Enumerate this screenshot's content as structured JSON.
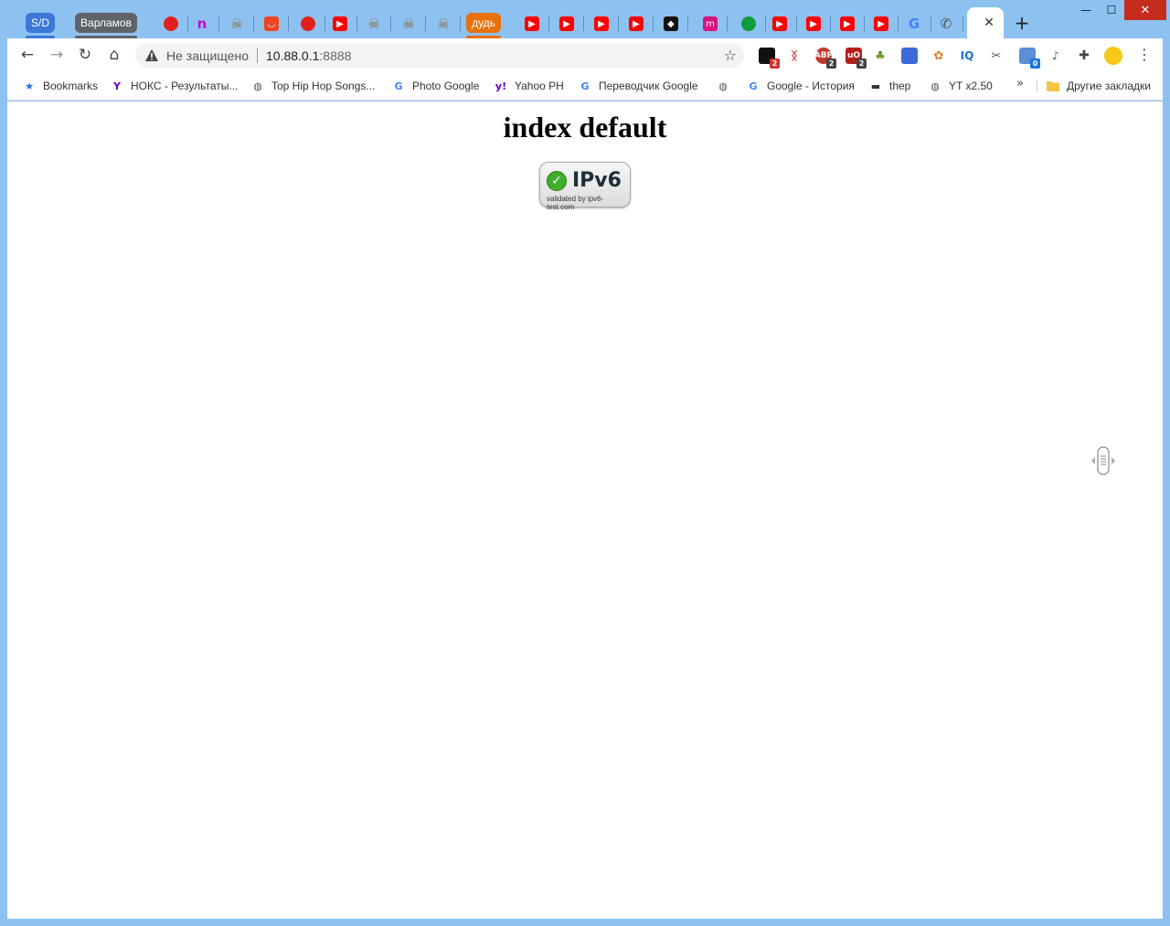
{
  "window": {
    "minimize_glyph": "—",
    "maximize_glyph": "☐",
    "close_glyph": "✕"
  },
  "tabs": {
    "group_sd": {
      "label": "S/D",
      "color": "#3b78d8"
    },
    "group_varlamov": {
      "label": "Варламов",
      "color": "#5f6368"
    },
    "group_dud": {
      "label": "дудь",
      "color": "#e8710a"
    },
    "favicons": [
      {
        "name": "red-dot-icon",
        "color": "#e0211b"
      },
      {
        "name": "purple-n-icon",
        "color": "#c40adb"
      },
      {
        "name": "pirate-icon",
        "color": "#8b6c3c"
      },
      {
        "name": "aliexpress-icon",
        "color": "#ee4422"
      },
      {
        "name": "red-dot-icon",
        "color": "#e0211b"
      },
      {
        "name": "youtube-icon",
        "color": "#ff0000"
      },
      {
        "name": "pirate-icon",
        "color": "#8b6c3c"
      },
      {
        "name": "pirate-icon",
        "color": "#8b6c3c"
      },
      {
        "name": "pirate-icon",
        "color": "#8b6c3c"
      },
      {
        "name": "youtube-icon",
        "color": "#ff0000"
      },
      {
        "name": "youtube-icon",
        "color": "#ff0000"
      },
      {
        "name": "youtube-icon",
        "color": "#ff0000"
      },
      {
        "name": "youtube-icon",
        "color": "#ff0000"
      },
      {
        "name": "black-diamond-icon",
        "color": "#111111"
      },
      {
        "name": "magenta-m-icon",
        "color": "#d6157f"
      },
      {
        "name": "green-dot-icon",
        "color": "#109d3b"
      },
      {
        "name": "youtube-icon",
        "color": "#ff0000"
      },
      {
        "name": "youtube-icon",
        "color": "#ff0000"
      },
      {
        "name": "youtube-icon",
        "color": "#ff0000"
      },
      {
        "name": "youtube-icon",
        "color": "#ff0000"
      },
      {
        "name": "google-icon",
        "color": "#4285f4"
      },
      {
        "name": "whatsapp-icon",
        "color": "#555555"
      }
    ],
    "active_close": "✕",
    "new_tab": "+"
  },
  "toolbar": {
    "back": "←",
    "forward": "→",
    "reload": "↻",
    "home": "⌂",
    "security_label": "Не защищено",
    "url_host": "10.88.0.1",
    "url_port": ":8888",
    "bookmark_star": "☆",
    "menu": "⋮"
  },
  "bookmarks": [
    {
      "label": "Bookmarks",
      "icon": "star-icon",
      "glyph": "★",
      "color": "#1a73e8"
    },
    {
      "label": "НОКС - Результаты...",
      "icon": "yandex-icon",
      "glyph": "Y",
      "color": "#6001d2"
    },
    {
      "label": "Top Hip Hop Songs...",
      "icon": "globe-icon",
      "glyph": "◍",
      "color": "#555555"
    },
    {
      "label": "Photo Google",
      "icon": "google-icon",
      "glyph": "G",
      "color": "#4285f4"
    },
    {
      "label": "Yahoo PH",
      "icon": "yahoo-icon",
      "glyph": "y!",
      "color": "#6001d2"
    },
    {
      "label": "Переводчик Google",
      "icon": "translate-icon",
      "glyph": "G",
      "color": "#4285f4"
    },
    {
      "label": "",
      "icon": "globe-icon",
      "glyph": "◍",
      "color": "#555555"
    },
    {
      "label": "Google - История",
      "icon": "google-icon",
      "glyph": "G",
      "color": "#4285f4"
    },
    {
      "label": "thep",
      "icon": "car-icon",
      "glyph": "▬",
      "color": "#333333"
    },
    {
      "label": "YT x2.50",
      "icon": "globe-icon",
      "glyph": "◍",
      "color": "#555555"
    }
  ],
  "bookmarks_overflow": "»",
  "other_bookmarks": "Другие закладки",
  "page": {
    "title": "index default",
    "badge_title": "IPv6",
    "badge_subtitle": "validated by ipv6-test.com"
  }
}
